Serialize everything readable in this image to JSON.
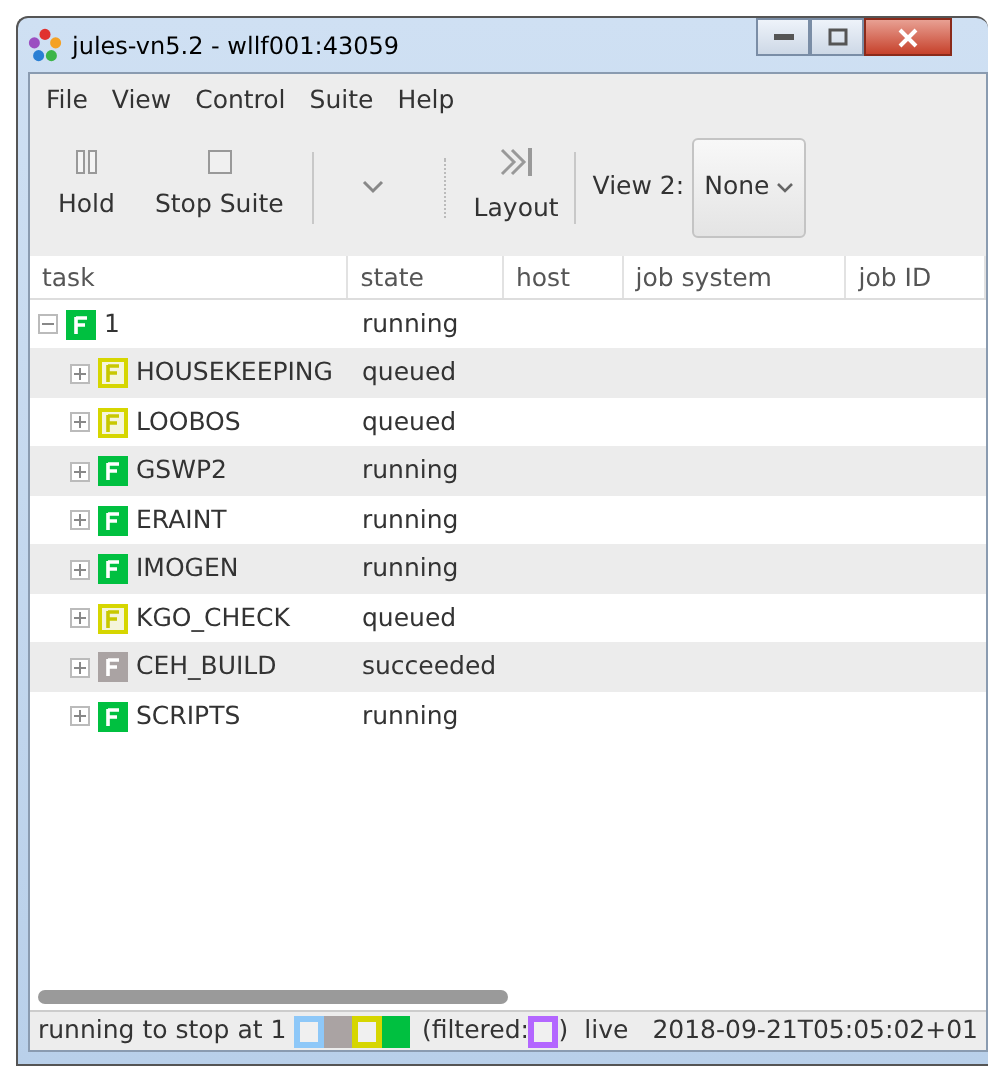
{
  "window": {
    "title": "jules-vn5.2 - wllf001:43059"
  },
  "menu": [
    "File",
    "View",
    "Control",
    "Suite",
    "Help"
  ],
  "toolbar": {
    "hold": "Hold",
    "stop": "Stop Suite",
    "layout": "Layout",
    "view2_label": "View 2:",
    "view2_value": "None"
  },
  "table": {
    "columns": [
      "task",
      "state",
      "host",
      "job system",
      "job ID"
    ],
    "rows": [
      {
        "task": "1",
        "state": "running",
        "kind": "running",
        "expanded": true,
        "children": [
          {
            "task": "HOUSEKEEPING",
            "state": "queued",
            "kind": "queued",
            "expanded": false
          },
          {
            "task": "LOOBOS",
            "state": "queued",
            "kind": "queued",
            "expanded": false
          },
          {
            "task": "GSWP2",
            "state": "running",
            "kind": "running",
            "expanded": false
          },
          {
            "task": "ERAINT",
            "state": "running",
            "kind": "running",
            "expanded": false
          },
          {
            "task": "IMOGEN",
            "state": "running",
            "kind": "running",
            "expanded": false
          },
          {
            "task": "KGO_CHECK",
            "state": "queued",
            "kind": "queued",
            "expanded": false
          },
          {
            "task": "CEH_BUILD",
            "state": "succeeded",
            "kind": "succeeded",
            "expanded": false
          },
          {
            "task": "SCRIPTS",
            "state": "running",
            "kind": "running",
            "expanded": false
          }
        ]
      }
    ]
  },
  "status_bar": {
    "message": "running to stop at 1",
    "swatches": [
      {
        "kind": "outline",
        "color": "#8ec8f8"
      },
      {
        "kind": "filled",
        "color": "#aaa3a3"
      },
      {
        "kind": "outline",
        "color": "#d6d600"
      },
      {
        "kind": "filled",
        "color": "#00c040"
      }
    ],
    "filtered_label": "(filtered:",
    "filtered_swatches": [
      {
        "kind": "outline",
        "color": "#b366ff"
      }
    ],
    "filtered_end": ")",
    "mode": "live",
    "time": "2018-09-21T05:05:02+01"
  }
}
